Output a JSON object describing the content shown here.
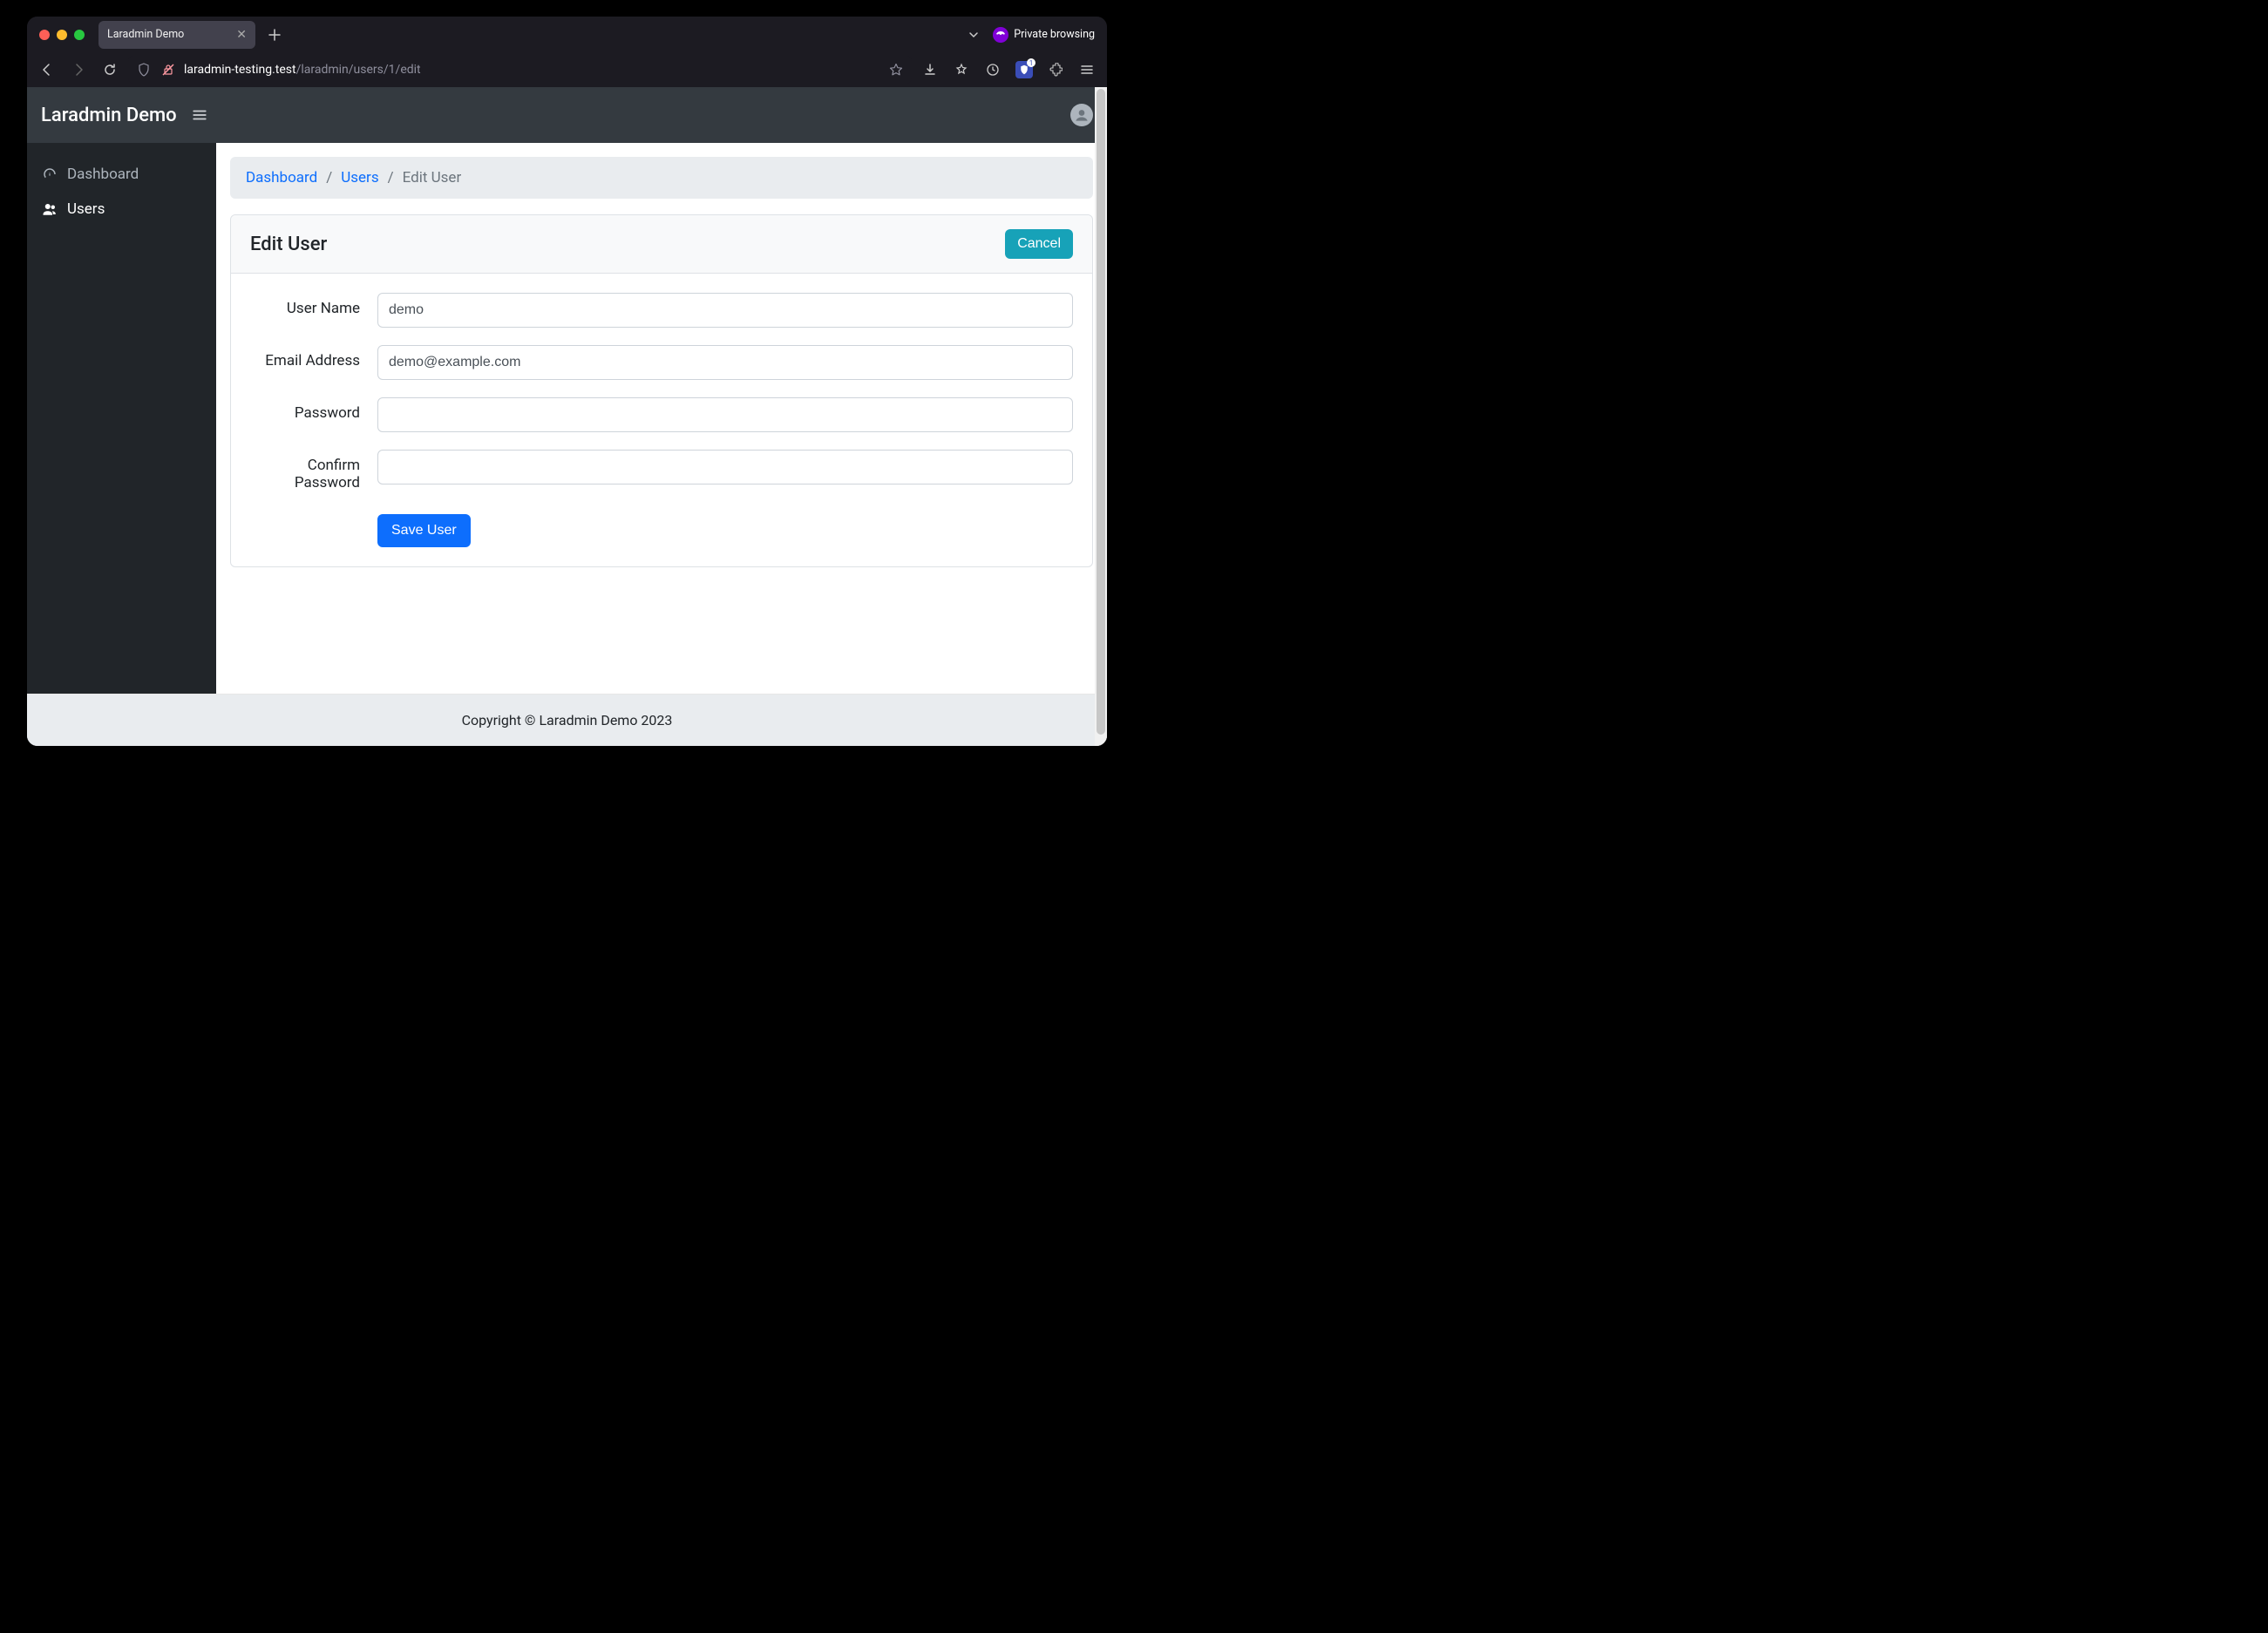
{
  "browser": {
    "tab_title": "Laradmin Demo",
    "private_label": "Private browsing",
    "url_host": "laradmin-testing.test",
    "url_path": "/laradmin/users/1/edit",
    "ext_badge_count": "1"
  },
  "header": {
    "app_title": "Laradmin Demo"
  },
  "sidebar": {
    "items": [
      {
        "label": "Dashboard"
      },
      {
        "label": "Users"
      }
    ]
  },
  "breadcrumb": {
    "dashboard": "Dashboard",
    "users": "Users",
    "current": "Edit User"
  },
  "card": {
    "title": "Edit User",
    "cancel": "Cancel"
  },
  "form": {
    "username_label": "User Name",
    "username_value": "demo",
    "email_label": "Email Address",
    "email_value": "demo@example.com",
    "password_label": "Password",
    "password_value": "",
    "confirm_label": "Confirm Password",
    "confirm_value": "",
    "save_label": "Save User"
  },
  "footer": {
    "text": "Copyright © Laradmin Demo 2023"
  }
}
